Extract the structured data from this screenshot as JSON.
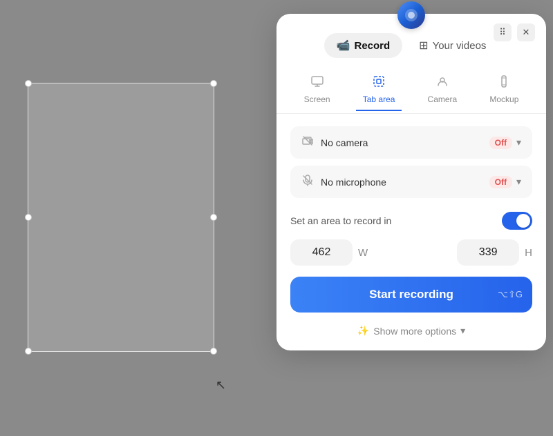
{
  "background": {
    "color": "#8a8a8a"
  },
  "panel": {
    "app_icon": "🔵",
    "window_controls": {
      "grid_icon": "⠿",
      "close_icon": "✕"
    },
    "top_tabs": [
      {
        "id": "record",
        "label": "Record",
        "icon": "📹",
        "active": true
      },
      {
        "id": "your-videos",
        "label": "Your videos",
        "icon": "⊞",
        "active": false
      }
    ],
    "mode_tabs": [
      {
        "id": "screen",
        "label": "Screen",
        "icon": "🖥",
        "active": false
      },
      {
        "id": "tab-area",
        "label": "Tab area",
        "icon": "⬚",
        "active": true
      },
      {
        "id": "camera",
        "label": "Camera",
        "icon": "👤",
        "active": false
      },
      {
        "id": "mockup",
        "label": "Mockup",
        "icon": "📱",
        "active": false
      }
    ],
    "options": [
      {
        "id": "camera",
        "icon": "📷",
        "label": "No camera",
        "badge": "Off"
      },
      {
        "id": "microphone",
        "icon": "🎤",
        "label": "No microphone",
        "badge": "Off"
      }
    ],
    "area_toggle": {
      "label": "Set an area to record in",
      "enabled": true
    },
    "dimensions": {
      "width_value": "462",
      "width_label": "W",
      "height_value": "339",
      "height_label": "H"
    },
    "record_button": {
      "label": "Start recording",
      "shortcut": "⌥⇧G"
    },
    "more_options": {
      "icon": "✨",
      "label": "Show more options",
      "chevron": "▾"
    }
  }
}
